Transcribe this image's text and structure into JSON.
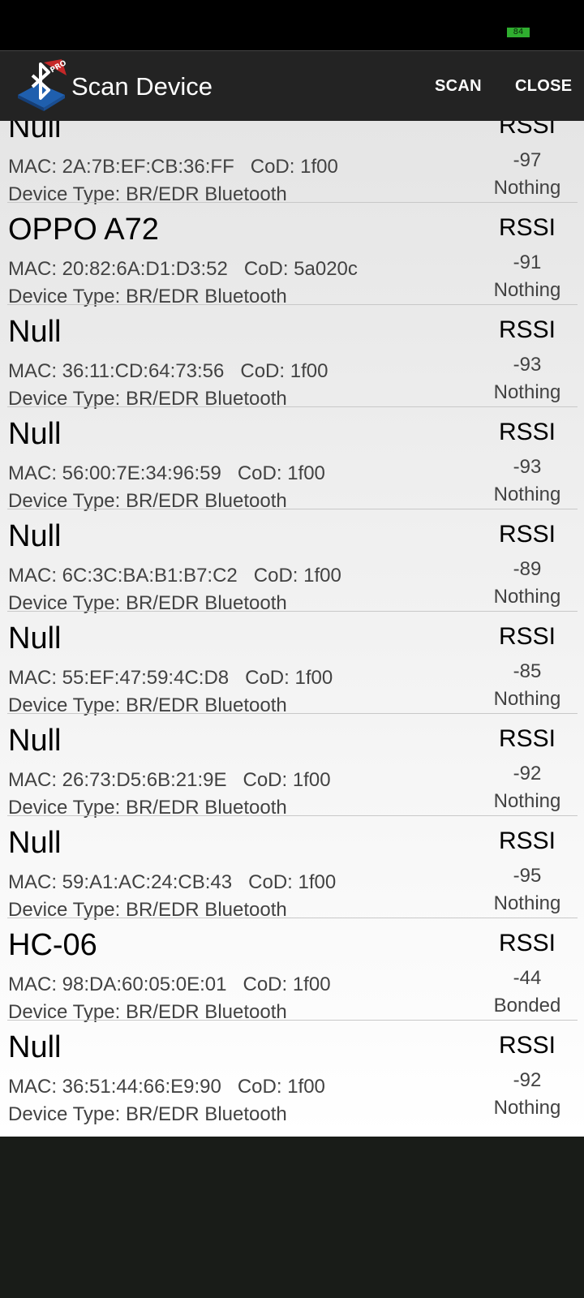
{
  "status_bar": {
    "battery_level": "84",
    "battery_color": "#2fae2f"
  },
  "toolbar": {
    "title": "Scan Device",
    "icon": "bluetooth-pro-icon",
    "scan_label": "SCAN",
    "close_label": "CLOSE"
  },
  "devices": [
    {
      "name": "Null",
      "mac_line": "MAC: 2A:7B:EF:CB:36:FF   CoD: 1f00",
      "type_line": "Device Type: BR/EDR Bluetooth",
      "rssi_label": "RSSI",
      "rssi": "-97",
      "bond": "Nothing"
    },
    {
      "name": "OPPO A72",
      "mac_line": "MAC: 20:82:6A:D1:D3:52   CoD: 5a020c",
      "type_line": "Device Type: BR/EDR Bluetooth",
      "rssi_label": "RSSI",
      "rssi": "-91",
      "bond": "Nothing"
    },
    {
      "name": "Null",
      "mac_line": "MAC: 36:11:CD:64:73:56   CoD: 1f00",
      "type_line": "Device Type: BR/EDR Bluetooth",
      "rssi_label": "RSSI",
      "rssi": "-93",
      "bond": "Nothing"
    },
    {
      "name": "Null",
      "mac_line": "MAC: 56:00:7E:34:96:59   CoD: 1f00",
      "type_line": "Device Type: BR/EDR Bluetooth",
      "rssi_label": "RSSI",
      "rssi": "-93",
      "bond": "Nothing"
    },
    {
      "name": "Null",
      "mac_line": "MAC: 6C:3C:BA:B1:B7:C2   CoD: 1f00",
      "type_line": "Device Type: BR/EDR Bluetooth",
      "rssi_label": "RSSI",
      "rssi": "-89",
      "bond": "Nothing"
    },
    {
      "name": "Null",
      "mac_line": "MAC: 55:EF:47:59:4C:D8   CoD: 1f00",
      "type_line": "Device Type: BR/EDR Bluetooth",
      "rssi_label": "RSSI",
      "rssi": "-85",
      "bond": "Nothing"
    },
    {
      "name": "Null",
      "mac_line": "MAC: 26:73:D5:6B:21:9E   CoD: 1f00",
      "type_line": "Device Type: BR/EDR Bluetooth",
      "rssi_label": "RSSI",
      "rssi": "-92",
      "bond": "Nothing"
    },
    {
      "name": "Null",
      "mac_line": "MAC: 59:A1:AC:24:CB:43   CoD: 1f00",
      "type_line": "Device Type: BR/EDR Bluetooth",
      "rssi_label": "RSSI",
      "rssi": "-95",
      "bond": "Nothing"
    },
    {
      "name": "HC-06",
      "mac_line": "MAC: 98:DA:60:05:0E:01   CoD: 1f00",
      "type_line": "Device Type: BR/EDR Bluetooth",
      "rssi_label": "RSSI",
      "rssi": "-44",
      "bond": "Bonded"
    },
    {
      "name": "Null",
      "mac_line": "MAC: 36:51:44:66:E9:90   CoD: 1f00",
      "type_line": "Device Type: BR/EDR Bluetooth",
      "rssi_label": "RSSI",
      "rssi": "-92",
      "bond": "Nothing"
    }
  ]
}
